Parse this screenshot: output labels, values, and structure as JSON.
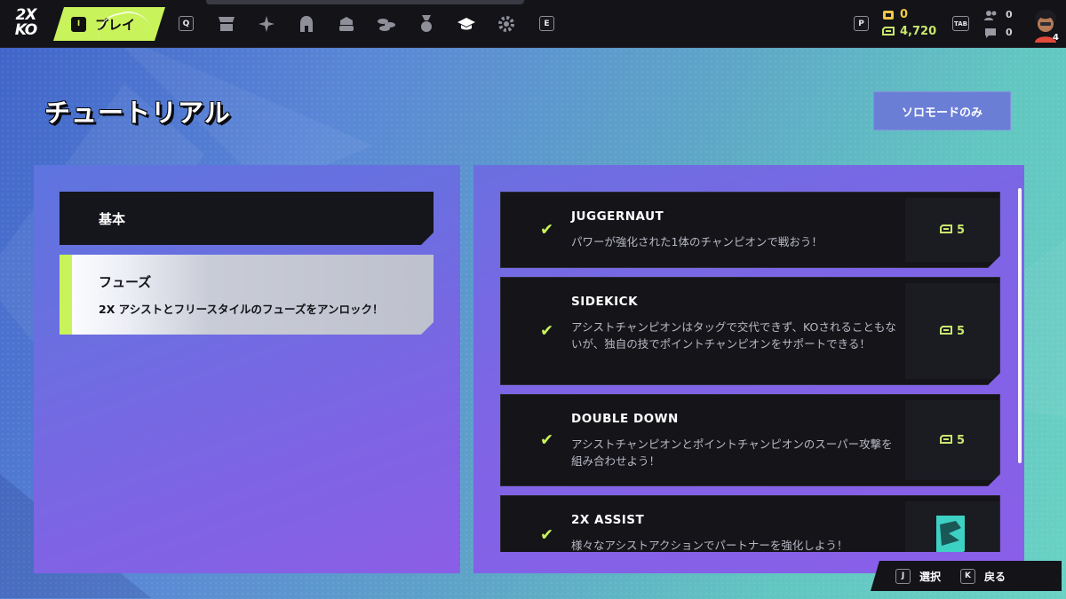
{
  "logo": {
    "line1": "2X",
    "line2": "KO"
  },
  "nav": {
    "play_key": "I",
    "play_label": "プレイ",
    "left_key": "Q",
    "right_key": "E",
    "icons": [
      "store-icon",
      "champions-icon",
      "armor-icon",
      "cosmetics-icon",
      "currency-icon",
      "medal-icon",
      "tutorial-icon",
      "settings-icon"
    ]
  },
  "profile": {
    "key": "P",
    "gold_value": "0",
    "currency_value": "4,720",
    "social_key": "TAB",
    "friends_count": "0",
    "messages_count": "0",
    "level": "4"
  },
  "page": {
    "title": "チュートリアル",
    "solo_button": "ソロモードのみ"
  },
  "categories": [
    {
      "title": "基本",
      "selected": false
    },
    {
      "title": "フューズ",
      "description": "2X アシストとフリースタイルのフューズをアンロック！",
      "selected": true
    }
  ],
  "lessons": [
    {
      "title": "JUGGERNAUT",
      "description": "パワーが強化された1体のチャンピオンで戦おう！",
      "reward": "5",
      "completed": true
    },
    {
      "title": "SIDEKICK",
      "description": "アシストチャンピオンはタッグで交代できず、KOされることもないが、独自の技でポイントチャンピオンをサポートできる！",
      "reward": "5",
      "completed": true
    },
    {
      "title": "DOUBLE DOWN",
      "description": "アシストチャンピオンとポイントチャンピオンのスーパー攻撃を組み合わせよう！",
      "reward": "5",
      "completed": true
    },
    {
      "title": "2X ASSIST",
      "description": "様々なアシストアクションでパートナーを強化しよう！",
      "reward": "",
      "completed": true
    }
  ],
  "prompts": {
    "select_key": "J",
    "select_label": "選択",
    "back_key": "K",
    "back_label": "戻る"
  },
  "colors": {
    "accent": "#c9f35a",
    "bar_bg": "#131318",
    "card_bg": "#141419"
  }
}
